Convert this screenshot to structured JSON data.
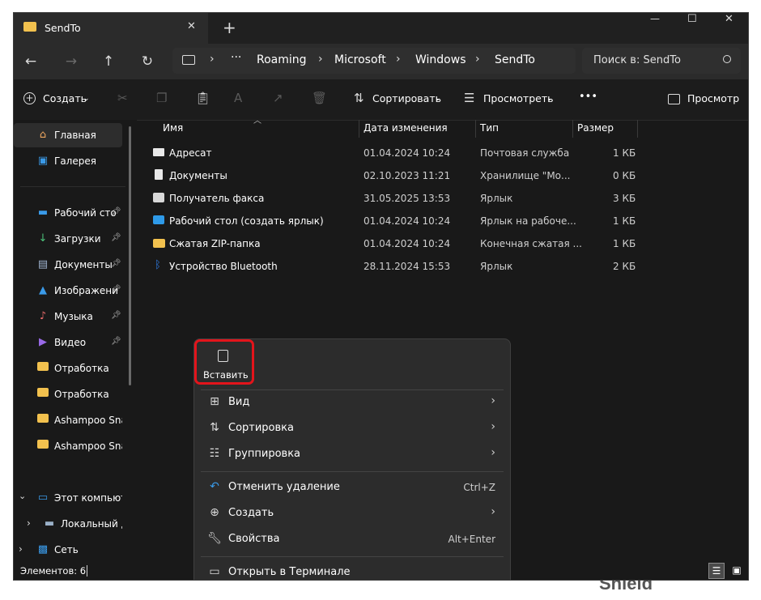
{
  "window": {
    "tab_title": "SendTo",
    "new_tab": "+",
    "close_tab": "✕",
    "min": "—",
    "max": "☐",
    "close": "✕"
  },
  "address": {
    "more": "···",
    "crumbs": [
      "Roaming",
      "Microsoft",
      "Windows",
      "SendTo"
    ],
    "search_placeholder": "Поиск в: SendTo"
  },
  "toolbar": {
    "create": "Создать",
    "sort": "Сортировать",
    "view": "Просмотреть",
    "more": "•••",
    "preview": "Просмотр"
  },
  "sidebar": {
    "items": [
      {
        "label": "Главная",
        "icon": "home-icon",
        "pinned": false
      },
      {
        "label": "Галерея",
        "icon": "gallery-icon",
        "pinned": false
      },
      {
        "label": "Рабочий сто",
        "icon": "desktop-icon",
        "pinned": true
      },
      {
        "label": "Загрузки",
        "icon": "download-icon",
        "pinned": true
      },
      {
        "label": "Документы",
        "icon": "documents-icon",
        "pinned": true
      },
      {
        "label": "Изображени",
        "icon": "pictures-icon",
        "pinned": true
      },
      {
        "label": "Музыка",
        "icon": "music-icon",
        "pinned": true
      },
      {
        "label": "Видео",
        "icon": "video-icon",
        "pinned": true
      },
      {
        "label": "Отработка",
        "icon": "folder-icon",
        "pinned": false
      },
      {
        "label": "Отработка",
        "icon": "folder-icon",
        "pinned": false
      },
      {
        "label": "Ashampoo Snap",
        "icon": "folder-icon",
        "pinned": false
      },
      {
        "label": "Ashampoo Snap",
        "icon": "folder-icon",
        "pinned": false
      },
      {
        "label": "Этот компьюте",
        "icon": "pc-icon",
        "pinned": false
      },
      {
        "label": "Локальный ди",
        "icon": "drive-icon",
        "pinned": false
      },
      {
        "label": "Сеть",
        "icon": "network-icon",
        "pinned": false
      }
    ]
  },
  "table": {
    "headers": [
      "Имя",
      "Дата изменения",
      "Тип",
      "Размер"
    ],
    "rows": [
      {
        "name": "Адресат",
        "date": "01.04.2024 10:24",
        "type": "Почтовая служба",
        "size": "1 КБ",
        "icon": "mail-icon",
        "color": "#e8e8e8"
      },
      {
        "name": "Документы",
        "date": "02.10.2023 11:21",
        "type": "Хранилище \"Мо...",
        "size": "0 КБ",
        "icon": "document-icon",
        "color": "#e8e8e8"
      },
      {
        "name": "Получатель факса",
        "date": "31.05.2025 13:53",
        "type": "Ярлык",
        "size": "3 КБ",
        "icon": "fax-icon",
        "color": "#d8d8d8"
      },
      {
        "name": "Рабочий стол (создать ярлык)",
        "date": "01.04.2024 10:24",
        "type": "Ярлык на рабоче...",
        "size": "1 КБ",
        "icon": "desktop-icon",
        "color": "#2e9ae8"
      },
      {
        "name": "Сжатая ZIP-папка",
        "date": "01.04.2024 10:24",
        "type": "Конечная сжатая ...",
        "size": "1 КБ",
        "icon": "zip-folder-icon",
        "color": "#f2c14e"
      },
      {
        "name": "Устройство Bluetooth",
        "date": "28.11.2024 15:53",
        "type": "Ярлык",
        "size": "2 КБ",
        "icon": "bluetooth-icon",
        "color": "#2e7de8"
      }
    ]
  },
  "context_menu": {
    "paste": "Вставить",
    "items": [
      {
        "label": "Вид",
        "shortcut": "",
        "submenu": true,
        "icon": "view-icon"
      },
      {
        "label": "Сортировка",
        "shortcut": "",
        "submenu": true,
        "icon": "sort-icon"
      },
      {
        "label": "Группировка",
        "shortcut": "",
        "submenu": true,
        "icon": "group-icon"
      },
      {
        "label": "Отменить удаление",
        "shortcut": "Ctrl+Z",
        "submenu": false,
        "icon": "undo-icon"
      },
      {
        "label": "Создать",
        "shortcut": "",
        "submenu": true,
        "icon": "new-icon"
      },
      {
        "label": "Свойства",
        "shortcut": "Alt+Enter",
        "submenu": false,
        "icon": "properties-icon"
      },
      {
        "label": "Открыть в Терминале",
        "shortcut": "",
        "submenu": false,
        "icon": "terminal-icon"
      }
    ]
  },
  "status": {
    "count": "Элементов: 6"
  },
  "colors": {
    "highlight": "#e3141b",
    "folder": "#f2c14e",
    "accent": "#2e9ae8"
  },
  "background_text": "Shield"
}
